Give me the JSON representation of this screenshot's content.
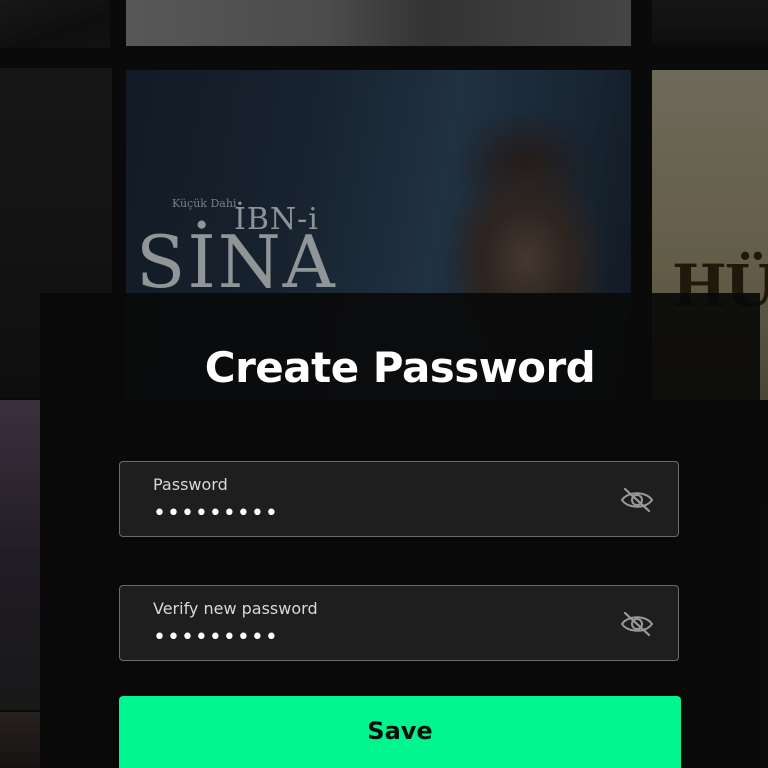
{
  "background": {
    "main_poster": {
      "subtitle": "Küçük Dahi",
      "title_top": "İBN-i",
      "title_bottom": "SİNA"
    },
    "right_poster": {
      "title": "HÜ"
    }
  },
  "modal": {
    "title": "Create Password",
    "password": {
      "label": "Password",
      "value": "•••••••••",
      "toggle_icon": "eye-off-icon"
    },
    "verify_password": {
      "label": "Verify new password",
      "value": "•••••••••",
      "toggle_icon": "eye-off-icon"
    },
    "save_label": "Save"
  },
  "colors": {
    "accent": "#00f58e",
    "modal_background": "#0a0a0a",
    "field_border": "#6a6a6a",
    "field_background": "#1e1e1e",
    "text_primary": "#ffffff",
    "text_label": "#d8d8d8"
  }
}
